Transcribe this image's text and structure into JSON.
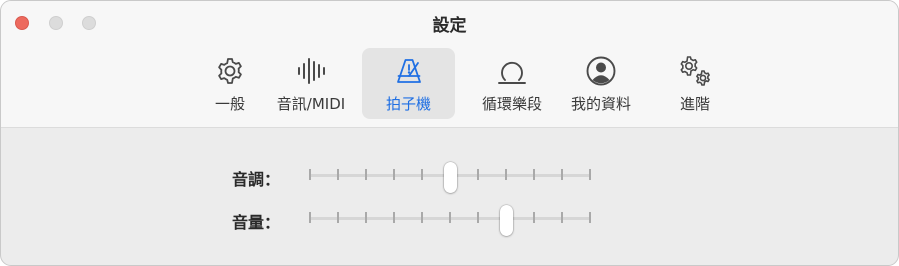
{
  "window": {
    "title": "設定"
  },
  "tabs": [
    {
      "label": "一般",
      "icon": "gear-icon"
    },
    {
      "label": "音訊/MIDI",
      "icon": "waveform-icon"
    },
    {
      "label": "拍子機",
      "icon": "metronome-icon",
      "active": true
    },
    {
      "label": "循環樂段",
      "icon": "loop-icon"
    },
    {
      "label": "我的資料",
      "icon": "person-circle-icon"
    },
    {
      "label": "進階",
      "icon": "gears-icon"
    }
  ],
  "colors": {
    "accent": "#1f6fe3",
    "close": "#ed6a5e"
  },
  "settings": {
    "pitch": {
      "label": "音調：",
      "ticks": 11,
      "value_index": 5
    },
    "volume": {
      "label": "音量：",
      "ticks": 11,
      "value_index": 7
    }
  }
}
